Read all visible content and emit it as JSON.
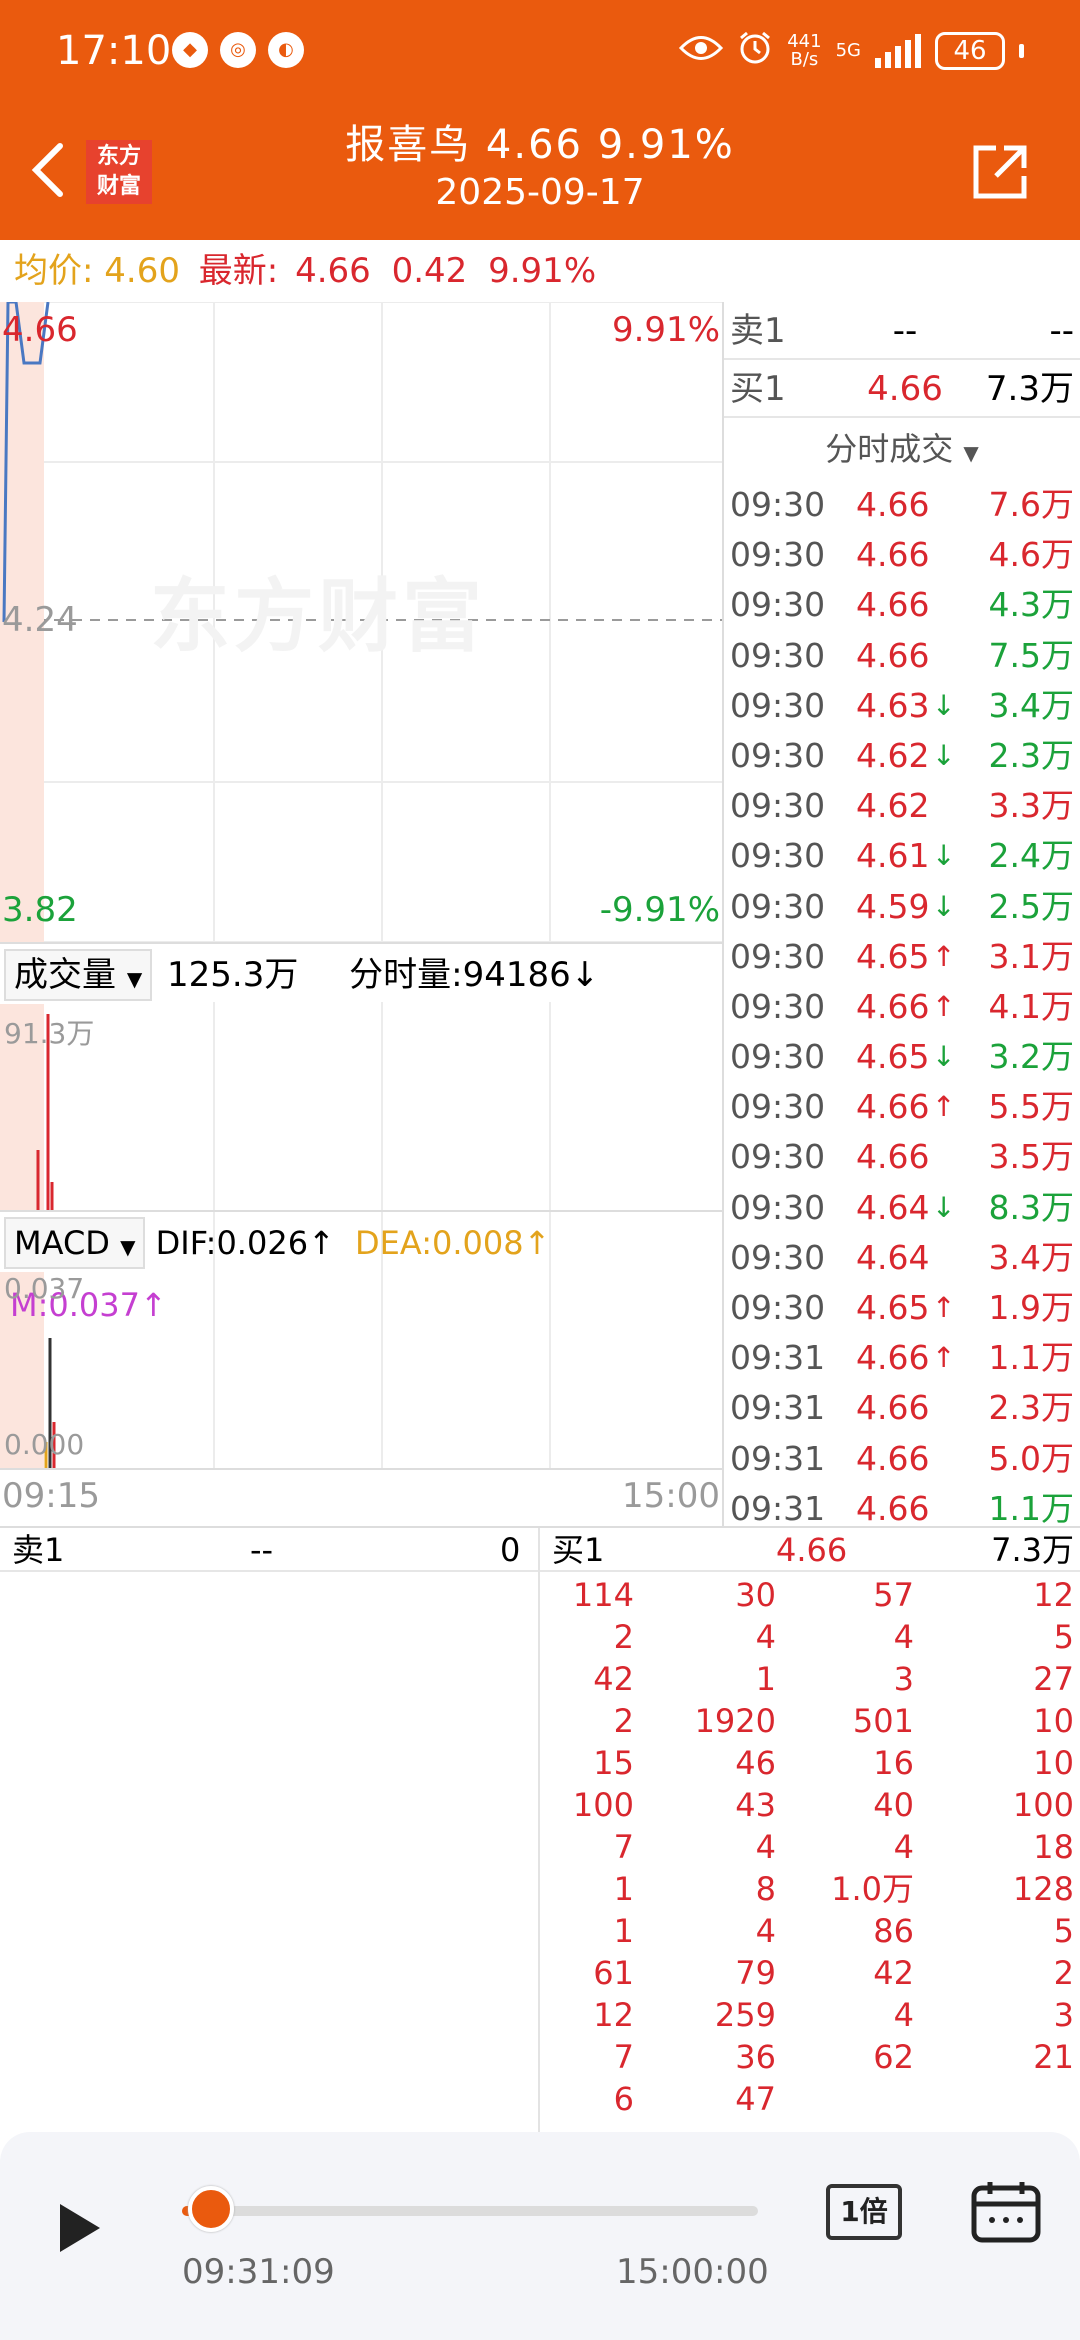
{
  "status": {
    "time": "17:10",
    "net_speed": "441",
    "net_unit": "B/s",
    "net_type": "5G",
    "battery": "46"
  },
  "header": {
    "logo_line1": "东方",
    "logo_line2": "财富",
    "title": "报喜鸟 4.66 9.91%",
    "date": "2025-09-17"
  },
  "info": {
    "avg_label": "均价:",
    "avg_value": "4.60",
    "latest_label": "最新:",
    "latest_price": "4.66",
    "latest_change": "0.42",
    "latest_pct": "9.91%"
  },
  "chart": {
    "top_price": "4.66",
    "top_pct": "9.91%",
    "mid_price": "4.24",
    "bottom_price": "3.82",
    "bottom_pct": "-9.91%",
    "watermark": "东方财富",
    "volume_label": "成交量",
    "volume_total": "125.3万",
    "volume_time": "分时量:94186↓",
    "volume_max": "91.3万",
    "macd_label": "MACD",
    "dif": "DIF:0.026↑",
    "dea": "DEA:0.008↑",
    "m": "M:0.037↑",
    "macd_top": "0.037",
    "macd_zero": "0.000",
    "time_start": "09:15",
    "time_end": "15:00",
    "price_series": [
      4.24,
      4.66,
      4.66,
      4.58,
      4.58,
      4.66
    ],
    "colors": {
      "price_line": "#4A78C2",
      "up": "#D9272E",
      "down": "#1BA23A",
      "dea": "#E3A31C",
      "m": "#C53FD1"
    }
  },
  "book": {
    "sell1": {
      "label": "卖1",
      "price": "--",
      "vol": "--"
    },
    "buy1": {
      "label": "买1",
      "price": "4.66",
      "vol": "7.3万"
    },
    "trades_title": "分时成交",
    "trades": [
      {
        "time": "09:30",
        "price": "4.66",
        "arrow": "",
        "vol": "7.6万",
        "side": "red"
      },
      {
        "time": "09:30",
        "price": "4.66",
        "arrow": "",
        "vol": "4.6万",
        "side": "red"
      },
      {
        "time": "09:30",
        "price": "4.66",
        "arrow": "",
        "vol": "4.3万",
        "side": "green"
      },
      {
        "time": "09:30",
        "price": "4.66",
        "arrow": "",
        "vol": "7.5万",
        "side": "green"
      },
      {
        "time": "09:30",
        "price": "4.63",
        "arrow": "↓",
        "vol": "3.4万",
        "side": "green"
      },
      {
        "time": "09:30",
        "price": "4.62",
        "arrow": "↓",
        "vol": "2.3万",
        "side": "green"
      },
      {
        "time": "09:30",
        "price": "4.62",
        "arrow": "",
        "vol": "3.3万",
        "side": "red"
      },
      {
        "time": "09:30",
        "price": "4.61",
        "arrow": "↓",
        "vol": "2.4万",
        "side": "green"
      },
      {
        "time": "09:30",
        "price": "4.59",
        "arrow": "↓",
        "vol": "2.5万",
        "side": "green"
      },
      {
        "time": "09:30",
        "price": "4.65",
        "arrow": "↑",
        "vol": "3.1万",
        "side": "red"
      },
      {
        "time": "09:30",
        "price": "4.66",
        "arrow": "↑",
        "vol": "4.1万",
        "side": "red"
      },
      {
        "time": "09:30",
        "price": "4.65",
        "arrow": "↓",
        "vol": "3.2万",
        "side": "green"
      },
      {
        "time": "09:30",
        "price": "4.66",
        "arrow": "↑",
        "vol": "5.5万",
        "side": "red"
      },
      {
        "time": "09:30",
        "price": "4.66",
        "arrow": "",
        "vol": "3.5万",
        "side": "red"
      },
      {
        "time": "09:30",
        "price": "4.64",
        "arrow": "↓",
        "vol": "8.3万",
        "side": "green"
      },
      {
        "time": "09:30",
        "price": "4.64",
        "arrow": "",
        "vol": "3.4万",
        "side": "red"
      },
      {
        "time": "09:30",
        "price": "4.65",
        "arrow": "↑",
        "vol": "1.9万",
        "side": "red"
      },
      {
        "time": "09:31",
        "price": "4.66",
        "arrow": "↑",
        "vol": "1.1万",
        "side": "red"
      },
      {
        "time": "09:31",
        "price": "4.66",
        "arrow": "",
        "vol": "2.3万",
        "side": "red"
      },
      {
        "time": "09:31",
        "price": "4.66",
        "arrow": "",
        "vol": "5.0万",
        "side": "red"
      },
      {
        "time": "09:31",
        "price": "4.66",
        "arrow": "",
        "vol": "1.1万",
        "side": "green"
      }
    ]
  },
  "queue": {
    "sell_label": "卖1",
    "sell_price": "--",
    "sell_vol": "0",
    "buy_label": "买1",
    "buy_price": "4.66",
    "buy_vol": "7.3万",
    "rows": [
      [
        "114",
        "30",
        "57",
        "12"
      ],
      [
        "2",
        "4",
        "4",
        "5"
      ],
      [
        "42",
        "1",
        "3",
        "27"
      ],
      [
        "2",
        "1920",
        "501",
        "10"
      ],
      [
        "15",
        "46",
        "16",
        "10"
      ],
      [
        "100",
        "43",
        "40",
        "100"
      ],
      [
        "7",
        "4",
        "4",
        "18"
      ],
      [
        "1",
        "8",
        "1.0万",
        "128"
      ],
      [
        "1",
        "4",
        "86",
        "5"
      ],
      [
        "61",
        "79",
        "42",
        "2"
      ],
      [
        "12",
        "259",
        "4",
        "3"
      ],
      [
        "7",
        "36",
        "62",
        "21"
      ],
      [
        "6",
        "47",
        "",
        ""
      ]
    ]
  },
  "player": {
    "current": "09:31:09",
    "end": "15:00:00",
    "speed": "1倍",
    "progress": 0.05
  }
}
